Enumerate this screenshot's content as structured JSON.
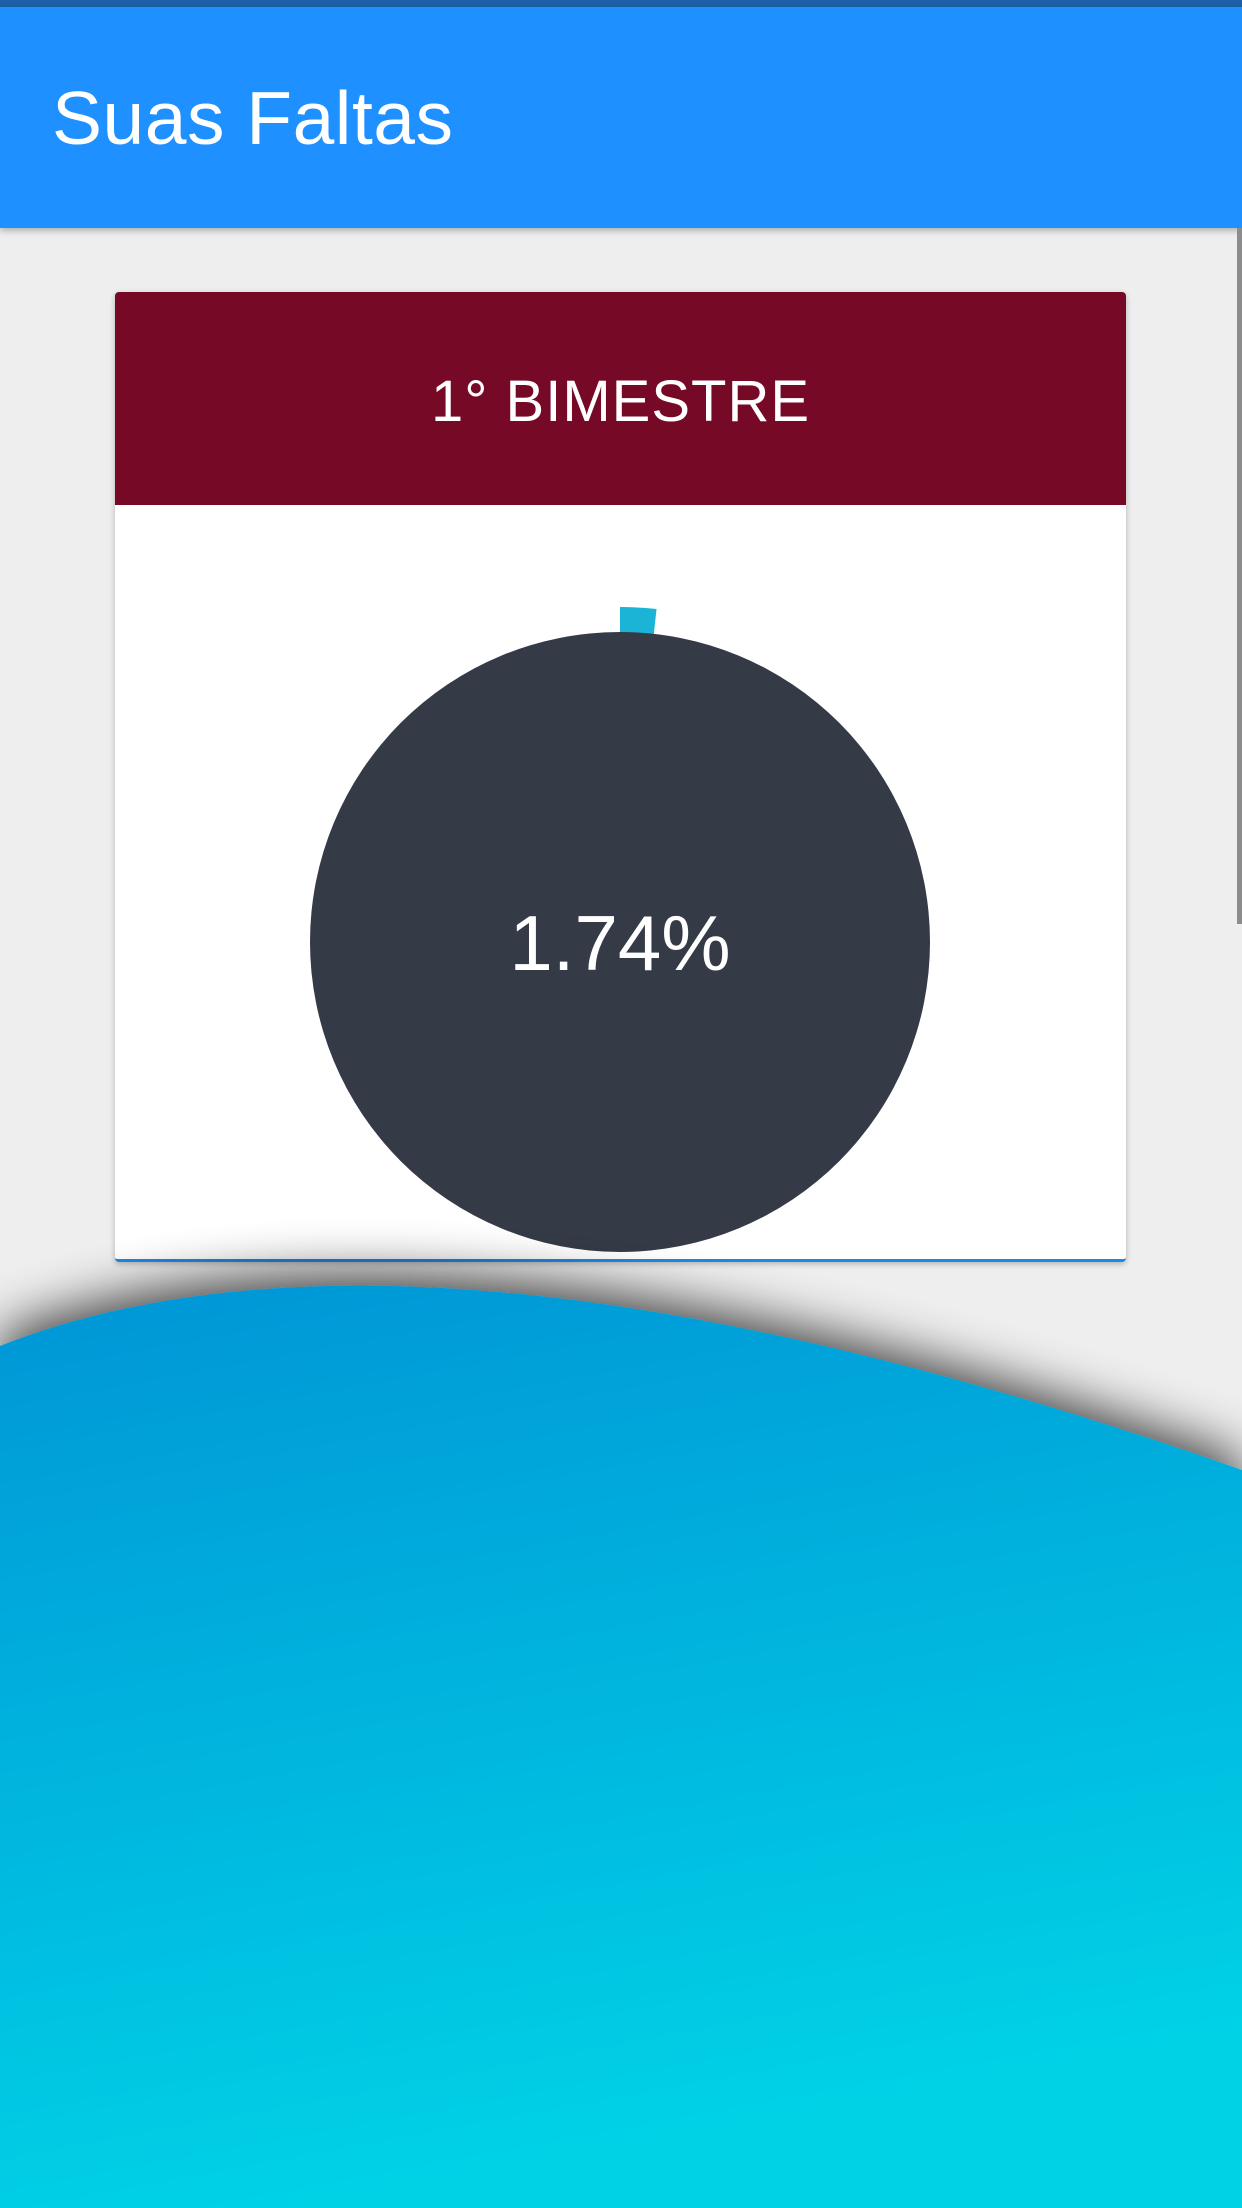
{
  "app_bar": {
    "title": "Suas Faltas",
    "color": "#1e90ff"
  },
  "card": {
    "header_title": "1° BIMESTRE",
    "header_color": "#760a26"
  },
  "chart_data": {
    "type": "pie",
    "slices": [
      {
        "value": 1.74,
        "color": "#1bb3d6"
      },
      {
        "value": 98.26,
        "color": "#343a46"
      }
    ],
    "center_label": "1.74%"
  },
  "background_wave": {
    "gradient_start": "#0095d6",
    "gradient_end": "#00d2e6"
  }
}
